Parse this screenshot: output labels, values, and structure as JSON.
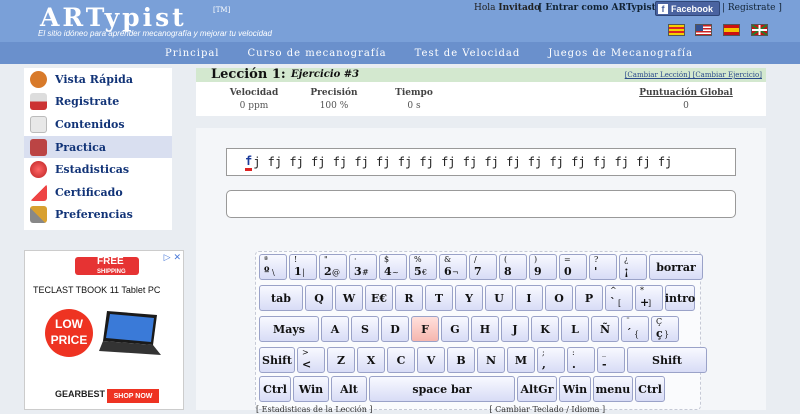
{
  "header": {
    "logo": "ARTypist",
    "tm": "[TM]",
    "tagline": "El sitio idóneo para aprender mecanografía y mejorar tu velocidad",
    "hola": "Hola",
    "user": "Invitado",
    "enter_link": "[ Entrar como ARTypist o",
    "facebook": "Facebook",
    "register": "| Registrate ]",
    "flags": [
      "catalan-flag",
      "us-flag",
      "spain-flag",
      "basque-flag"
    ]
  },
  "nav": {
    "items": [
      "Principal",
      "Curso de mecanografía",
      "Test de Velocidad",
      "Juegos de Mecanografía"
    ]
  },
  "sidebar": {
    "items": [
      {
        "label": "Vista Rápida",
        "icon": "face-icon",
        "color": "#d87a2a"
      },
      {
        "label": "Registrate",
        "icon": "free-icon",
        "color": "#c33"
      },
      {
        "label": "Contenidos",
        "icon": "page-icon",
        "color": "#ddd"
      },
      {
        "label": "Practica",
        "icon": "typewriter-icon",
        "color": "#b44"
      },
      {
        "label": "Estadisticas",
        "icon": "globe-icon",
        "color": "#c44"
      },
      {
        "label": "Certificado",
        "icon": "certificate-icon",
        "color": "#e44"
      },
      {
        "label": "Preferencias",
        "icon": "tools-icon",
        "color": "#d8a030"
      }
    ],
    "active_index": 3
  },
  "ad": {
    "badge": "FREE",
    "badge_sub": "SHIPPING",
    "title": "TECLAST TBOOK 11 Tablet PC",
    "low_price": "LOW PRICE",
    "brand": "GEARBEST",
    "shop": "SHOP NOW",
    "close": "▷ ✕"
  },
  "lesson": {
    "label": "Lección 1:",
    "exercise": "Ejercicio #3",
    "change_links": "[Cambiar Lección] [Cambiar Ejercicio]"
  },
  "stats": {
    "speed_label": "Velocidad",
    "speed": "0 ppm",
    "precision_label": "Precisión",
    "precision": "100 %",
    "time_label": "Tiempo",
    "time": "0 s",
    "score_label": "Puntuación Global",
    "score": "0"
  },
  "exercise_text": {
    "current": "f",
    "rest": "j fj fj fj fj fj fj fj fj fj fj fj fj fj fj fj fj fj fj fj"
  },
  "keyboard": {
    "rows": [
      [
        {
          "up": "ª",
          "lo": "º",
          "lo2": "\\"
        },
        {
          "up": "!",
          "lo": "1",
          "lo2": "|"
        },
        {
          "up": "\"",
          "lo": "2",
          "lo2": "@"
        },
        {
          "up": "·",
          "lo": "3",
          "lo2": "#"
        },
        {
          "up": "$",
          "lo": "4",
          "lo2": "~"
        },
        {
          "up": "%",
          "lo": "5",
          "lo2": "€"
        },
        {
          "up": "&",
          "lo": "6",
          "lo2": "¬"
        },
        {
          "up": "/",
          "lo": "7",
          "lo2": ""
        },
        {
          "up": "(",
          "lo": "8",
          "lo2": ""
        },
        {
          "up": ")",
          "lo": "9",
          "lo2": ""
        },
        {
          "up": "=",
          "lo": "0",
          "lo2": ""
        },
        {
          "up": "?",
          "lo": "'",
          "lo2": ""
        },
        {
          "up": "¿",
          "lo": "¡",
          "lo2": ""
        },
        {
          "label": "borrar"
        }
      ],
      [
        {
          "label": "tab"
        },
        {
          "label": "Q"
        },
        {
          "label": "W"
        },
        {
          "label": "E€"
        },
        {
          "label": "R"
        },
        {
          "label": "T"
        },
        {
          "label": "Y"
        },
        {
          "label": "U"
        },
        {
          "label": "I"
        },
        {
          "label": "O"
        },
        {
          "label": "P"
        },
        {
          "up": "^",
          "lo": "`",
          "lo2": "["
        },
        {
          "up": "*",
          "lo": "+",
          "lo2": "]"
        },
        {
          "label": "intro"
        }
      ],
      [
        {
          "label": "Mays"
        },
        {
          "label": "A"
        },
        {
          "label": "S"
        },
        {
          "label": "D"
        },
        {
          "label": "F"
        },
        {
          "label": "G"
        },
        {
          "label": "H"
        },
        {
          "label": "J"
        },
        {
          "label": "K"
        },
        {
          "label": "L"
        },
        {
          "label": "Ñ"
        },
        {
          "up": "¨",
          "lo": "´",
          "lo2": "{"
        },
        {
          "up": "Ç",
          "lo": "ç",
          "lo2": "}"
        }
      ],
      [
        {
          "label": "Shift"
        },
        {
          "up": ">",
          "lo": "<",
          "lo2": ""
        },
        {
          "label": "Z"
        },
        {
          "label": "X"
        },
        {
          "label": "C"
        },
        {
          "label": "V"
        },
        {
          "label": "B"
        },
        {
          "label": "N"
        },
        {
          "label": "M"
        },
        {
          "up": ";",
          "lo": ",",
          "lo2": ""
        },
        {
          "up": ":",
          "lo": ".",
          "lo2": ""
        },
        {
          "up": "_",
          "lo": "-",
          "lo2": ""
        },
        {
          "label": "Shift"
        }
      ],
      [
        {
          "label": "Ctrl"
        },
        {
          "label": "Win"
        },
        {
          "label": "Alt"
        },
        {
          "label": "space bar"
        },
        {
          "label": "AltGr"
        },
        {
          "label": "Win"
        },
        {
          "label": "menu"
        },
        {
          "label": "Ctrl"
        }
      ]
    ],
    "highlight": "F"
  },
  "bottom_links": "[ Estadisticas de la Lección ]                                              [ Cambiar Teclado / Idioma ]"
}
